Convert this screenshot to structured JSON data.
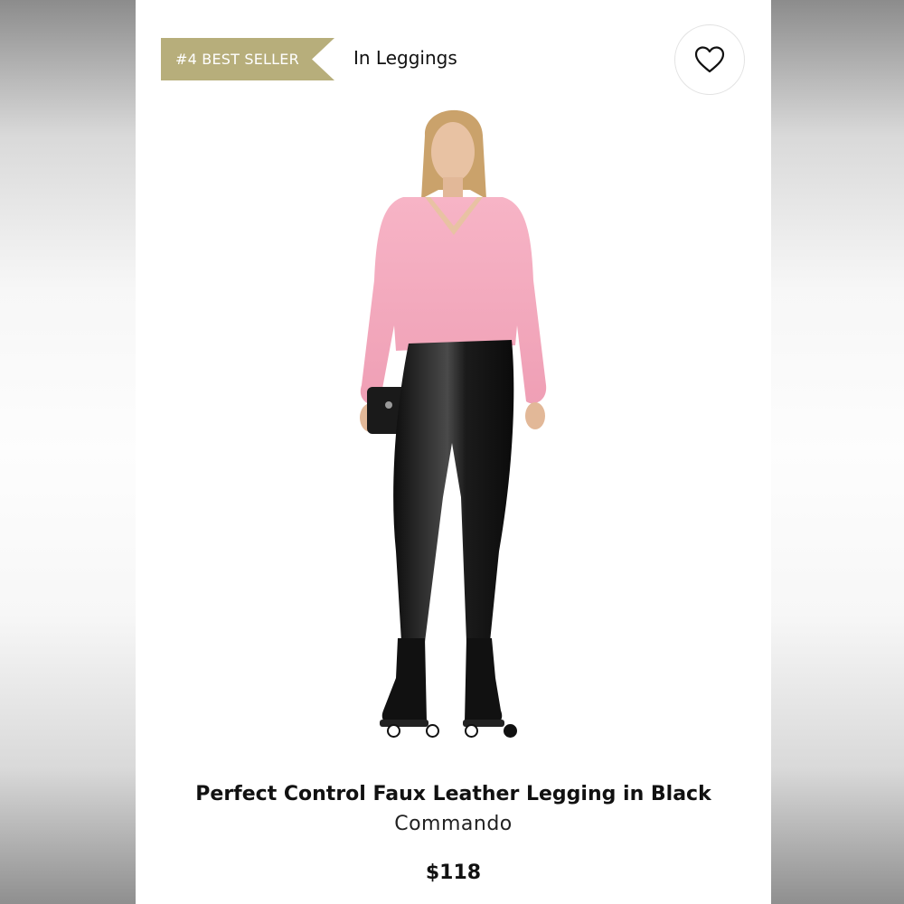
{
  "badge": {
    "text": "#4 BEST SELLER",
    "color": "#b7ae7b"
  },
  "category": {
    "text": "In Leggings"
  },
  "wishlist": {
    "icon": "heart-outline-icon"
  },
  "product": {
    "name": "Perfect Control Faux Leather Legging in Black",
    "brand": "Commando",
    "price": "$118"
  },
  "carousel": {
    "total": 4,
    "active_index": 3
  },
  "colors": {
    "sweater": "#f4a9bd",
    "legging": "#141414"
  }
}
